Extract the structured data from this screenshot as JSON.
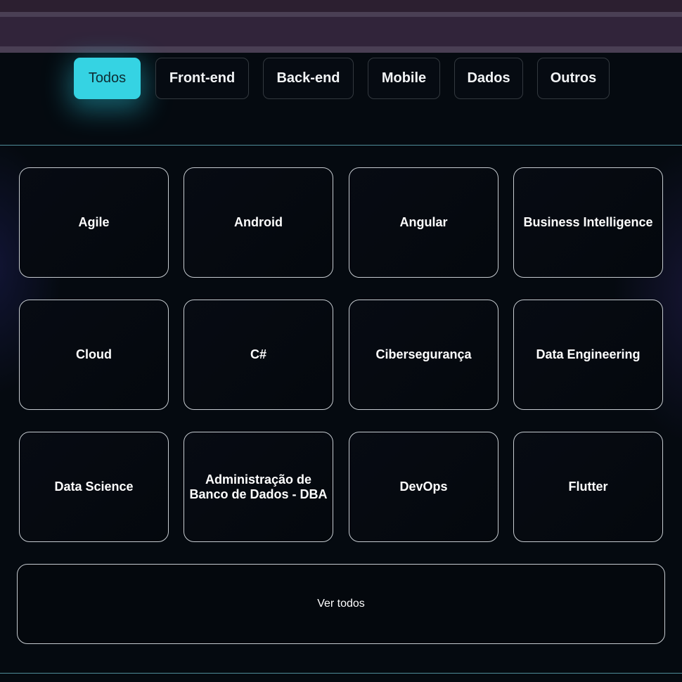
{
  "filters": {
    "items": [
      {
        "label": "Todos",
        "active": true
      },
      {
        "label": "Front-end",
        "active": false
      },
      {
        "label": "Back-end",
        "active": false
      },
      {
        "label": "Mobile",
        "active": false
      },
      {
        "label": "Dados",
        "active": false
      },
      {
        "label": "Outros",
        "active": false
      }
    ]
  },
  "categories": {
    "items": [
      {
        "label": "Agile"
      },
      {
        "label": "Android"
      },
      {
        "label": "Angular"
      },
      {
        "label": "Business Intelligence"
      },
      {
        "label": "Cloud"
      },
      {
        "label": "C#"
      },
      {
        "label": "Cibersegurança"
      },
      {
        "label": "Data Engineering"
      },
      {
        "label": "Data Science"
      },
      {
        "label": "Administração de Banco de Dados - DBA"
      },
      {
        "label": "DevOps"
      },
      {
        "label": "Flutter"
      }
    ],
    "see_all_label": "Ver todos"
  },
  "colors": {
    "accent": "#35d3e3",
    "background": "#050a10",
    "topbar": "#31243a",
    "card_border": "#c6cbd0",
    "divider": "#4f8d99"
  }
}
